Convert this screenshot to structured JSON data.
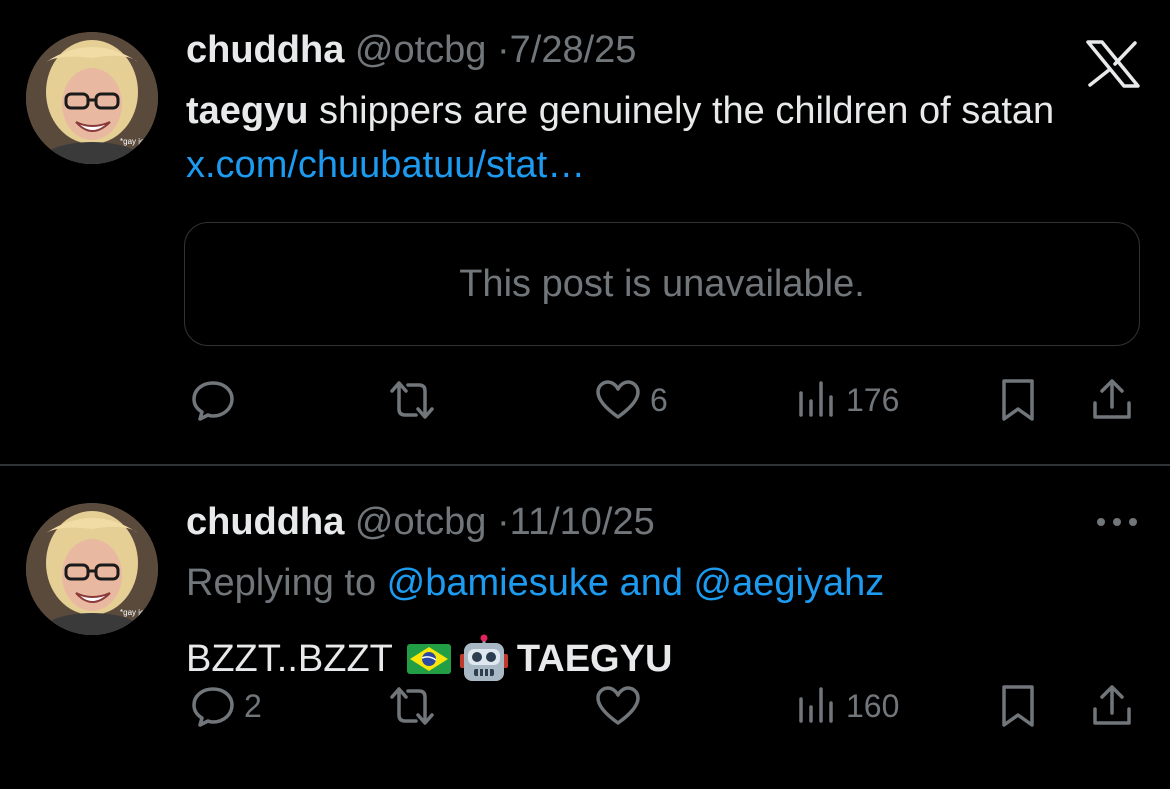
{
  "posts": [
    {
      "author_name": "chuddha",
      "handle": "@otcbg",
      "separator": "·",
      "date": "7/28/25",
      "avatar_caption": "*gay joy*",
      "text_highlight": "taegyu",
      "text_rest": " shippers are genuinely the children of satan ",
      "link_text": "x.com/chuubatuu/stat…",
      "embed_text": "This post is unavailable.",
      "reply_count": "",
      "like_count": "6",
      "view_count": "176",
      "corner_icon": "x-logo-icon"
    },
    {
      "author_name": "chuddha",
      "handle": "@otcbg",
      "separator": "·",
      "date": "11/10/25",
      "avatar_caption": "*gay joy*",
      "replying_prefix": "Replying to ",
      "replying_user1": "@bamiesuke",
      "replying_and": " and ",
      "replying_user2": "@aegiyahz",
      "text_plain": "BZZT..BZZT",
      "text_bold": "TAEGYU",
      "flag_icon": "brazil-flag-icon",
      "emoji_icon": "robot-icon",
      "reply_count": "2",
      "like_count": "",
      "view_count": "160",
      "corner_icon": "more-dots-icon"
    }
  ],
  "colors": {
    "background": "#000000",
    "text": "#e7e9ea",
    "muted": "#71767b",
    "link": "#1d9bf0",
    "border": "#2f3336"
  }
}
